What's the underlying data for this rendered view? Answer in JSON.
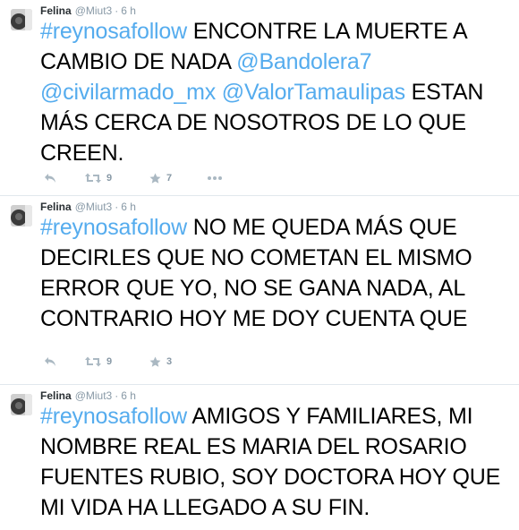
{
  "tweets": [
    {
      "fullname": "Felina",
      "username": "@Miut3",
      "separator": "·",
      "time": "6 h",
      "text": {
        "hashtag": "#reynosafollow",
        "lines_1": " ENCONTRE LA MUERTE A CAMBIO DE NADA ",
        "mention_1": "@Bandolera7",
        "mention_2": "@civilarmado_mx",
        "space": " ",
        "mention_3": "@ValorTamaulipas",
        "lines_2": " ESTAN MÁS CERCA DE NOSOTROS DE LO QUE CREEN."
      },
      "retweets": "9",
      "favorites": "7"
    },
    {
      "fullname": "Felina",
      "username": "@Miut3",
      "separator": "·",
      "time": "6 h",
      "text": {
        "hashtag": "#reynosafollow",
        "body": " NO ME QUEDA MÁS QUE DECIRLES QUE NO COMETAN EL MISMO ERROR QUE YO, NO SE GANA NADA, AL CONTRARIO HOY ME DOY CUENTA QUE"
      },
      "retweets": "9",
      "favorites": "3"
    },
    {
      "fullname": "Felina",
      "username": "@Miut3",
      "separator": "·",
      "time": "6 h",
      "text": {
        "hashtag": "#reynosafollow",
        "body": " AMIGOS Y FAMILIARES, MI NOMBRE REAL ES MARIA DEL ROSARIO FUENTES RUBIO,  SOY DOCTORA HOY QUE MI VIDA HA LLEGADO A SU FIN."
      }
    }
  ],
  "icons": {
    "reply": "reply-icon",
    "retweet": "retweet-icon",
    "favorite": "star-icon",
    "more": "more-icon"
  },
  "colors": {
    "link": "#55acee",
    "meta": "#8899a6",
    "divider": "#e1e8ed"
  }
}
